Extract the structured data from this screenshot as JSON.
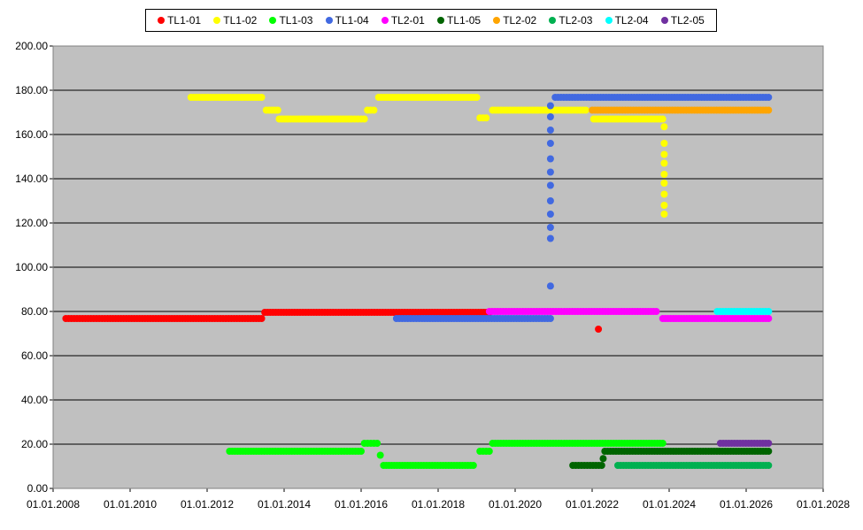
{
  "chart_data": {
    "type": "scatter",
    "title": "",
    "xlabel": "",
    "ylabel": "",
    "xlim": [
      "2008-01-01",
      "2028-01-01"
    ],
    "ylim": [
      0,
      200
    ],
    "x_ticks": [
      "01.01.2008",
      "01.01.2010",
      "01.01.2012",
      "01.01.2014",
      "01.01.2016",
      "01.01.2018",
      "01.01.2020",
      "01.01.2022",
      "01.01.2024",
      "01.01.2026",
      "01.01.2028"
    ],
    "y_ticks": [
      "0.00",
      "20.00",
      "40.00",
      "60.00",
      "80.00",
      "100.00",
      "120.00",
      "140.00",
      "160.00",
      "180.00",
      "200.00"
    ],
    "grid": "horizontal",
    "legend_position": "top",
    "background": "#c0c0c0",
    "series": [
      {
        "name": "TL1-01",
        "color": "#ff0000",
        "points": [
          [
            "2008-05-01",
            76.8
          ],
          [
            "2009-06-01",
            76.8
          ],
          [
            "2010-09-01",
            76.8
          ],
          [
            "2011-12-01",
            76.8
          ],
          [
            "2013-06-01",
            76.8
          ],
          [
            "2013-07-01",
            79.6
          ],
          [
            "2014-06-01",
            79.6
          ],
          [
            "2015-06-01",
            79.6
          ],
          [
            "2016-06-01",
            79.6
          ],
          [
            "2017-06-01",
            79.6
          ],
          [
            "2018-06-01",
            79.6
          ],
          [
            "2019-05-01",
            79.6
          ],
          [
            "2022-03-01",
            72
          ]
        ]
      },
      {
        "name": "TL1-02",
        "color": "#ffff00",
        "points": [
          [
            "2011-08-01",
            176.8
          ],
          [
            "2012-10-01",
            176.8
          ],
          [
            "2013-06-01",
            176.8
          ],
          [
            "2013-07-15",
            171
          ],
          [
            "2013-11-01",
            171
          ],
          [
            "2013-11-15",
            167
          ],
          [
            "2014-10-01",
            167
          ],
          [
            "2015-10-01",
            167
          ],
          [
            "2016-02-01",
            167
          ],
          [
            "2016-03-01",
            171
          ],
          [
            "2016-05-01",
            171
          ],
          [
            "2016-06-15",
            176.8
          ],
          [
            "2017-04-01",
            176.8
          ],
          [
            "2018-03-01",
            176.8
          ],
          [
            "2019-01-01",
            176.8
          ],
          [
            "2019-02-01",
            167.5
          ],
          [
            "2019-04-01",
            167.5
          ],
          [
            "2019-06-01",
            171
          ],
          [
            "2020-03-01",
            171
          ],
          [
            "2021-02-01",
            171
          ],
          [
            "2021-11-01",
            171
          ],
          [
            "2022-01-15",
            167
          ],
          [
            "2022-09-01",
            167
          ],
          [
            "2023-04-01",
            167
          ],
          [
            "2023-11-01",
            167
          ],
          [
            "2023-11-15",
            163.5
          ],
          [
            "2023-11-15",
            156
          ],
          [
            "2023-11-15",
            151
          ],
          [
            "2023-11-15",
            147
          ],
          [
            "2023-11-15",
            142
          ],
          [
            "2023-11-15",
            138
          ],
          [
            "2023-11-15",
            133
          ],
          [
            "2023-11-15",
            128
          ],
          [
            "2023-11-15",
            124
          ]
        ]
      },
      {
        "name": "TL1-03",
        "color": "#00ff00",
        "points": [
          [
            "2012-08-01",
            16.8
          ],
          [
            "2013-06-01",
            16.8
          ],
          [
            "2014-06-01",
            16.8
          ],
          [
            "2015-06-01",
            16.8
          ],
          [
            "2016-01-01",
            16.8
          ],
          [
            "2016-02-01",
            20.4
          ],
          [
            "2016-06-01",
            20.4
          ],
          [
            "2016-07-01",
            15
          ],
          [
            "2016-08-01",
            10.4
          ],
          [
            "2017-06-01",
            10.4
          ],
          [
            "2018-06-01",
            10.4
          ],
          [
            "2018-12-01",
            10.4
          ],
          [
            "2019-02-01",
            16.8
          ],
          [
            "2019-05-01",
            16.8
          ],
          [
            "2019-06-01",
            20.4
          ],
          [
            "2020-06-01",
            20.4
          ],
          [
            "2021-06-01",
            20.4
          ],
          [
            "2022-06-01",
            20.4
          ],
          [
            "2023-11-01",
            20.4
          ]
        ]
      },
      {
        "name": "TL1-04",
        "color": "#4169e1",
        "points": [
          [
            "2016-12-01",
            76.8
          ],
          [
            "2017-08-01",
            76.8
          ],
          [
            "2018-06-01",
            76.8
          ],
          [
            "2019-04-01",
            76.8
          ],
          [
            "2020-04-01",
            76.8
          ],
          [
            "2020-12-01",
            76.8
          ],
          [
            "2020-12-01",
            91.5
          ],
          [
            "2020-12-01",
            113
          ],
          [
            "2020-12-01",
            118
          ],
          [
            "2020-12-01",
            124
          ],
          [
            "2020-12-01",
            130
          ],
          [
            "2020-12-01",
            137
          ],
          [
            "2020-12-01",
            143
          ],
          [
            "2020-12-01",
            149
          ],
          [
            "2020-12-01",
            156
          ],
          [
            "2020-12-01",
            162
          ],
          [
            "2020-12-01",
            168
          ],
          [
            "2020-12-01",
            173
          ],
          [
            "2021-01-15",
            176.8
          ],
          [
            "2022-01-01",
            176.8
          ],
          [
            "2023-03-01",
            176.8
          ],
          [
            "2024-06-01",
            176.8
          ],
          [
            "2025-06-01",
            176.8
          ],
          [
            "2026-08-01",
            176.8
          ]
        ]
      },
      {
        "name": "TL2-01",
        "color": "#ff00ff",
        "points": [
          [
            "2019-05-01",
            80
          ],
          [
            "2020-06-01",
            80
          ],
          [
            "2021-06-01",
            80
          ],
          [
            "2022-06-01",
            80
          ],
          [
            "2023-09-01",
            80
          ],
          [
            "2023-11-01",
            76.8
          ],
          [
            "2024-09-01",
            76.8
          ],
          [
            "2025-08-01",
            76.8
          ],
          [
            "2026-08-01",
            76.8
          ]
        ]
      },
      {
        "name": "TL1-05",
        "color": "#006400",
        "points": [
          [
            "2021-07-01",
            10.4
          ],
          [
            "2022-04-01",
            10.4
          ],
          [
            "2022-04-15",
            13.5
          ],
          [
            "2022-05-01",
            16.8
          ],
          [
            "2023-06-01",
            16.8
          ],
          [
            "2024-09-01",
            16.8
          ],
          [
            "2025-09-01",
            16.8
          ],
          [
            "2026-08-01",
            16.8
          ]
        ]
      },
      {
        "name": "TL2-02",
        "color": "#ffa500",
        "points": [
          [
            "2022-01-01",
            171
          ],
          [
            "2023-01-01",
            171
          ],
          [
            "2024-02-01",
            171
          ],
          [
            "2025-03-01",
            171
          ],
          [
            "2026-08-01",
            171
          ]
        ]
      },
      {
        "name": "TL2-03",
        "color": "#00b050",
        "points": [
          [
            "2022-09-01",
            10.4
          ],
          [
            "2023-09-01",
            10.4
          ],
          [
            "2024-09-01",
            10.4
          ],
          [
            "2025-09-01",
            10.4
          ],
          [
            "2026-08-01",
            10.4
          ]
        ]
      },
      {
        "name": "TL2-04",
        "color": "#00ffff",
        "points": [
          [
            "2025-04-01",
            80
          ],
          [
            "2025-12-01",
            80
          ],
          [
            "2026-08-01",
            80
          ]
        ]
      },
      {
        "name": "TL2-05",
        "color": "#7030a0",
        "points": [
          [
            "2025-05-01",
            20.4
          ],
          [
            "2025-12-01",
            20.4
          ],
          [
            "2026-08-01",
            20.4
          ]
        ]
      }
    ]
  }
}
